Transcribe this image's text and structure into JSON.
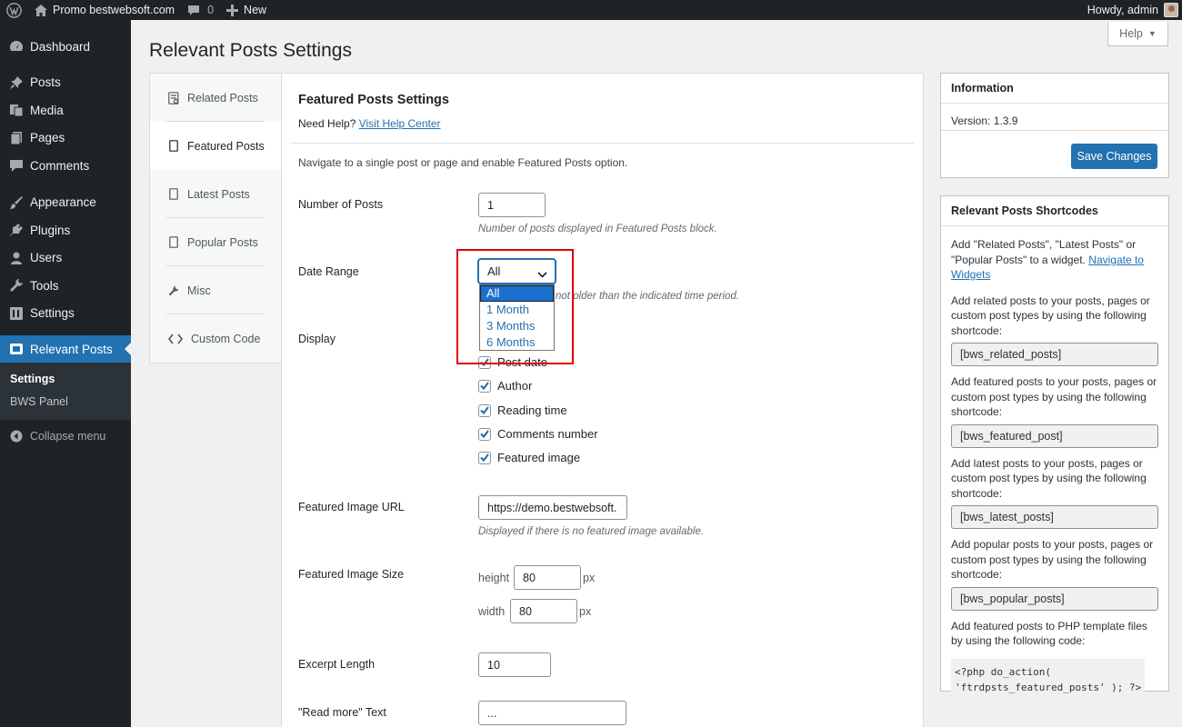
{
  "admin_bar": {
    "site_name": "Promo bestwebsoft.com",
    "comments_count": "0",
    "new_label": "New",
    "greeting": "Howdy, admin"
  },
  "sidebar": {
    "items": [
      {
        "label": "Dashboard",
        "icon": "dashboard-icon"
      },
      {
        "label": "Posts",
        "icon": "pin-icon"
      },
      {
        "label": "Media",
        "icon": "media-icon"
      },
      {
        "label": "Pages",
        "icon": "pages-icon"
      },
      {
        "label": "Comments",
        "icon": "comment-icon"
      },
      {
        "label": "Appearance",
        "icon": "brush-icon"
      },
      {
        "label": "Plugins",
        "icon": "plugin-icon"
      },
      {
        "label": "Users",
        "icon": "users-icon"
      },
      {
        "label": "Tools",
        "icon": "wrench-icon"
      },
      {
        "label": "Settings",
        "icon": "settings-icon"
      },
      {
        "label": "Relevant Posts",
        "icon": "bws-icon"
      }
    ],
    "submenu": [
      "Settings",
      "BWS Panel"
    ],
    "collapse_label": "Collapse menu"
  },
  "page": {
    "title": "Relevant Posts Settings",
    "help_label": "Help"
  },
  "tabs": [
    {
      "label": "Related Posts",
      "icon": "related-doc-icon"
    },
    {
      "label": "Featured Posts",
      "icon": "doc-icon"
    },
    {
      "label": "Latest Posts",
      "icon": "doc-icon"
    },
    {
      "label": "Popular Posts",
      "icon": "doc-icon"
    },
    {
      "label": "Misc",
      "icon": "wrench-icon"
    },
    {
      "label": "Custom Code",
      "icon": "code-icon"
    }
  ],
  "content": {
    "heading": "Featured Posts Settings",
    "need_help": "Need Help?",
    "help_link": "Visit Help Center",
    "intro": "Navigate to a single post or page and enable Featured Posts option.",
    "number_of_posts": {
      "label": "Number of Posts",
      "value": "1",
      "desc": "Number of posts displayed in Featured Posts block."
    },
    "date_range": {
      "label": "Date Range",
      "value": "All",
      "desc_visible": "not older than the indicated time period.",
      "options": [
        "All",
        "1 Month",
        "3 Months",
        "6 Months"
      ]
    },
    "display": {
      "label": "Display",
      "options": [
        "Post date",
        "Author",
        "Reading time",
        "Comments number",
        "Featured image"
      ],
      "checked": [
        true,
        true,
        true,
        true,
        true
      ]
    },
    "featured_image_url": {
      "label": "Featured Image URL",
      "value": "https://demo.bestwebsoft.",
      "desc": "Displayed if there is no featured image available."
    },
    "featured_image_size": {
      "label": "Featured Image Size",
      "height_label": "height",
      "height_value": "80",
      "width_label": "width",
      "width_value": "80",
      "unit": "px"
    },
    "excerpt_length": {
      "label": "Excerpt Length",
      "value": "10"
    },
    "read_more": {
      "label": "\"Read more\" Text",
      "value": "..."
    }
  },
  "info_box": {
    "title": "Information",
    "version": "Version: 1.3.9",
    "save_label": "Save Changes"
  },
  "shortcodes_box": {
    "title": "Relevant Posts Shortcodes",
    "intro_text": "Add \"Related Posts\", \"Latest Posts\" or \"Popular Posts\" to a widget.",
    "intro_link": "Navigate to Widgets",
    "blocks": [
      {
        "text": "Add related posts to your posts, pages or custom post types by using the following shortcode:",
        "code": "[bws_related_posts]"
      },
      {
        "text": "Add featured posts to your posts, pages or custom post types by using the following shortcode:",
        "code": "[bws_featured_post]"
      },
      {
        "text": "Add latest posts to your posts, pages or custom post types by using the following shortcode:",
        "code": "[bws_latest_posts]"
      },
      {
        "text": "Add popular posts to your posts, pages or custom post types by using the following shortcode:",
        "code": "[bws_popular_posts]"
      }
    ],
    "php_text": "Add featured posts to PHP template files by using the following code:",
    "php_code_line1": "<?php do_action(",
    "php_code_line2": "'ftrdpsts_featured_posts' ); ?>"
  },
  "colors": {
    "admin_dark": "#1d2327",
    "accent": "#2271b1",
    "highlight_box": "#e00000"
  }
}
